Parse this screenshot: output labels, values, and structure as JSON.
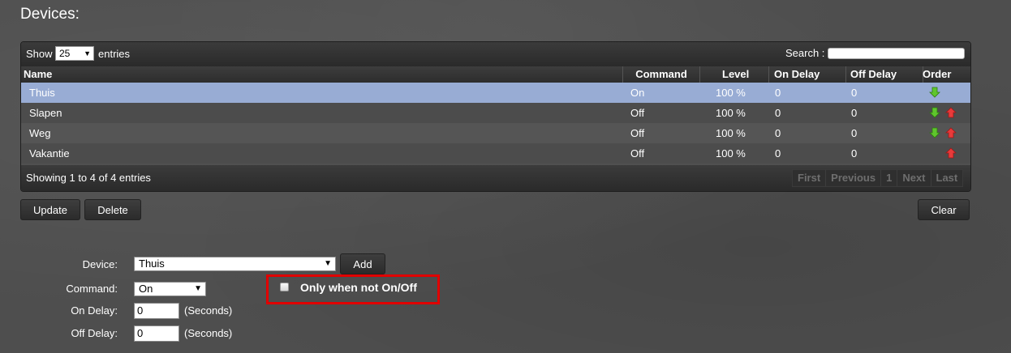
{
  "page_title": "Devices:",
  "table": {
    "show_label": "Show",
    "entries_value": "25",
    "entries_label": "entries",
    "search_label": "Search :",
    "search_value": "",
    "columns": {
      "name": "Name",
      "command": "Command",
      "level": "Level",
      "on_delay": "On Delay",
      "off_delay": "Off Delay",
      "order": "Order"
    },
    "rows": [
      {
        "name": "Thuis",
        "command": "On",
        "level": "100 %",
        "on_delay": "0",
        "off_delay": "0",
        "order_down": true,
        "order_up": false,
        "selected": true
      },
      {
        "name": "Slapen",
        "command": "Off",
        "level": "100 %",
        "on_delay": "0",
        "off_delay": "0",
        "order_down": true,
        "order_up": true,
        "selected": false
      },
      {
        "name": "Weg",
        "command": "Off",
        "level": "100 %",
        "on_delay": "0",
        "off_delay": "0",
        "order_down": true,
        "order_up": true,
        "selected": false
      },
      {
        "name": "Vakantie",
        "command": "Off",
        "level": "100 %",
        "on_delay": "0",
        "off_delay": "0",
        "order_down": false,
        "order_up": true,
        "selected": false
      }
    ],
    "info": "Showing 1 to 4 of 4 entries",
    "pager": {
      "first": "First",
      "previous": "Previous",
      "page": "1",
      "next": "Next",
      "last": "Last"
    }
  },
  "buttons": {
    "update": "Update",
    "delete": "Delete",
    "clear": "Clear",
    "add": "Add"
  },
  "form": {
    "device_label": "Device:",
    "device_value": "Thuis",
    "command_label": "Command:",
    "command_value": "On",
    "on_delay_label": "On Delay:",
    "on_delay_value": "0",
    "off_delay_label": "Off Delay:",
    "off_delay_value": "0",
    "seconds_label": "(Seconds)",
    "only_when_label": "Only when not On/Off",
    "only_when_checked": false
  },
  "colors": {
    "selected_row": "#98acd4",
    "highlight_border": "#e00000",
    "arrow_down": "#5fc62c",
    "arrow_up": "#e83a3a"
  },
  "icons": {
    "order_down": "green-arrow-down-icon",
    "order_up": "red-arrow-up-icon",
    "dropdown": "chevron-down-icon"
  }
}
